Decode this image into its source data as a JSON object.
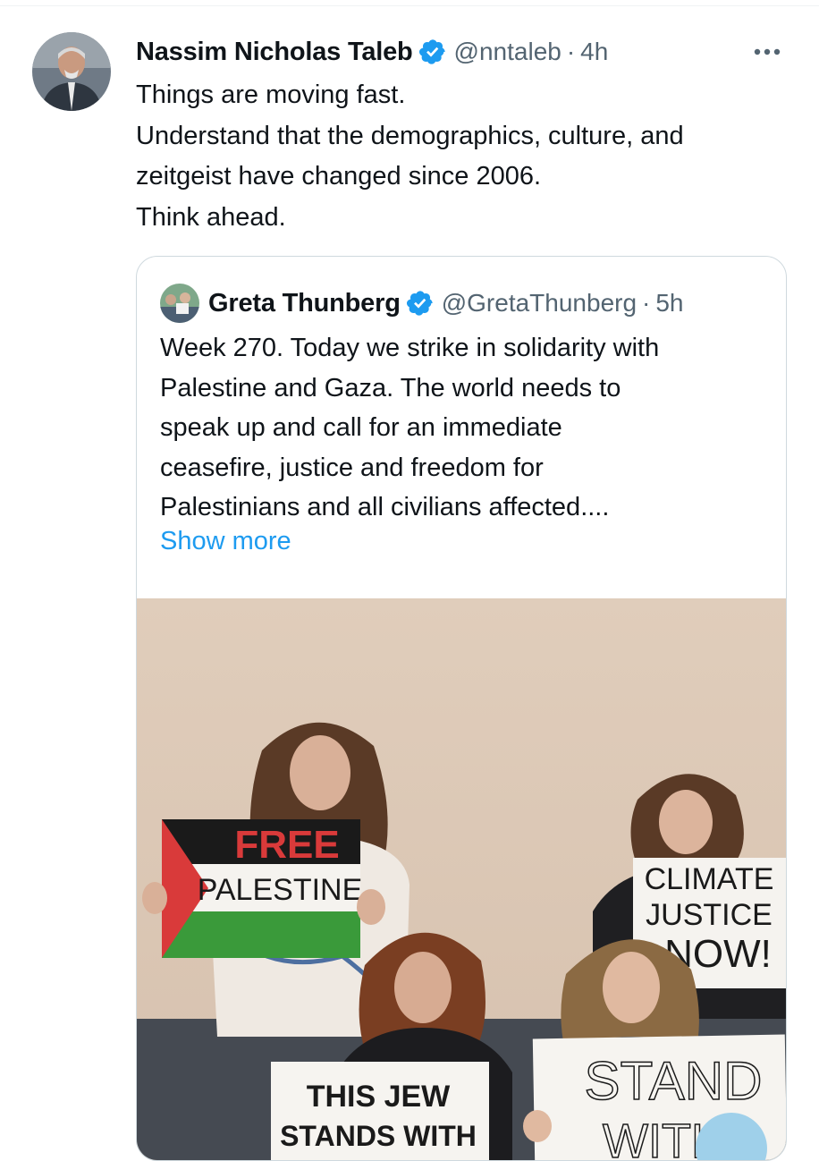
{
  "tweet": {
    "author_name": "Nassim Nicholas Taleb",
    "handle": "@nntaleb",
    "separator": "·",
    "time": "4h",
    "avatar_icon": "profile-photo",
    "verified_icon": "verified-badge-icon",
    "more_icon": "more-options-icon",
    "lines": [
      "Things are moving fast.",
      "Understand that the demographics, culture, and",
      "zeitgeist have changed since 2006.",
      "Think ahead."
    ]
  },
  "quoted_tweet": {
    "author_name": "Greta Thunberg",
    "handle": "@GretaThunberg",
    "separator": "·",
    "time": "5h",
    "lines": [
      "Week 270. Today we strike in solidarity with",
      "Palestine and Gaza. The world needs to",
      "speak up and call for an immediate",
      "ceasefire, justice and freedom for",
      "Palestinians and all civilians affected...."
    ],
    "show_more": "Show more",
    "media": {
      "signs": {
        "free": "FREE",
        "palestine": "PALESTINE",
        "climate": "CLIMATE",
        "justice": "JUSTICE",
        "now": "NOW!",
        "jew_line1": "THIS JEW",
        "jew_line2": "STANDS WITH",
        "stand": "STAND",
        "with": "WITH"
      }
    }
  },
  "colors": {
    "link": "#1d9bf0",
    "secondary_text": "#536471",
    "border": "#cfd9de",
    "verified": "#1d9bf0"
  }
}
